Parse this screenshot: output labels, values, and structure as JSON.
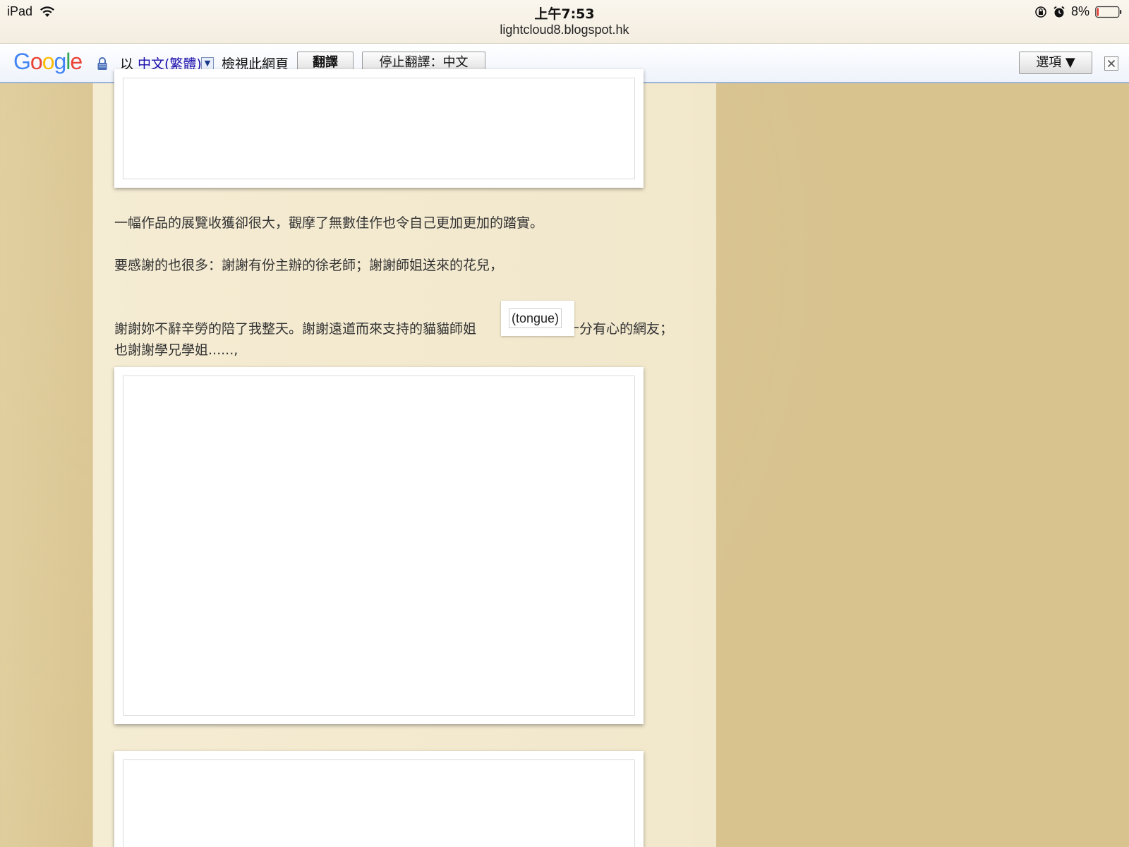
{
  "status_bar": {
    "device": "iPad",
    "time": "上午7:53",
    "url": "lightcloud8.blogspot.hk",
    "battery": "8%",
    "battery_level": 0.08
  },
  "translate_bar": {
    "logo": "Google",
    "prefix": "以",
    "language": "中文(繁體)",
    "dropdown_glyph": "▼",
    "suffix": "檢視此網頁",
    "translate_button": "翻譯",
    "stop_button": "停止翻譯：中文",
    "options_button": "選項 ▼"
  },
  "post": {
    "paragraphs": [
      "一幅作品的展覽收獲卻很大，觀摩了無數佳作也令自己更加更加的踏實。",
      "要感謝的也很多：謝謝有份主辦的徐老師；謝謝師姐送來的花兒，",
      "謝謝妳不辭辛勞的陪了我整天。謝謝遠道而來支持的貓貓師姐",
      "和十分有心的網友；也謝謝學兄學姐......,"
    ],
    "emoticon_alt": "(tongue)"
  },
  "colors": {
    "page_bg": "#d8c38f",
    "column_bg": "#efe4c6",
    "link": "#1a0dab",
    "translate_bar_border": "#9db3d6",
    "battery_low": "#e53935"
  }
}
